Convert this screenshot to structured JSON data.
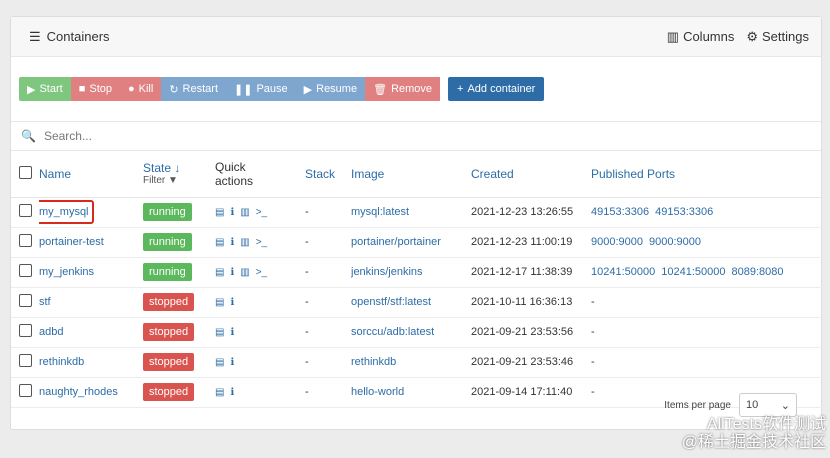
{
  "header": {
    "title": "Containers",
    "columns_label": "Columns",
    "settings_label": "Settings"
  },
  "toolbar": {
    "start": "Start",
    "stop": "Stop",
    "kill": "Kill",
    "restart": "Restart",
    "pause": "Pause",
    "resume": "Resume",
    "remove": "Remove",
    "add": "Add container"
  },
  "search": {
    "placeholder": "Search..."
  },
  "columns": {
    "name": "Name",
    "state": "State",
    "filter": "Filter",
    "quick_actions_1": "Quick",
    "quick_actions_2": "actions",
    "stack": "Stack",
    "image": "Image",
    "created": "Created",
    "ports": "Published Ports"
  },
  "rows": [
    {
      "name": "my_mysql",
      "state": "running",
      "stack": "-",
      "image": "mysql:latest",
      "created": "2021-12-23 13:26:55",
      "ports": [
        "49153:3306",
        "49153:3306"
      ]
    },
    {
      "name": "portainer-test",
      "state": "running",
      "stack": "-",
      "image": "portainer/portainer",
      "created": "2021-12-23 11:00:19",
      "ports": [
        "9000:9000",
        "9000:9000"
      ]
    },
    {
      "name": "my_jenkins",
      "state": "running",
      "stack": "-",
      "image": "jenkins/jenkins",
      "created": "2021-12-17 11:38:39",
      "ports": [
        "10241:50000",
        "10241:50000",
        "8089:8080"
      ]
    },
    {
      "name": "stf",
      "state": "stopped",
      "stack": "-",
      "image": "openstf/stf:latest",
      "created": "2021-10-11 16:36:13",
      "ports_text": "-"
    },
    {
      "name": "adbd",
      "state": "stopped",
      "stack": "-",
      "image": "sorccu/adb:latest",
      "created": "2021-09-21 23:53:56",
      "ports_text": "-"
    },
    {
      "name": "rethinkdb",
      "state": "stopped",
      "stack": "-",
      "image": "rethinkdb",
      "created": "2021-09-21 23:53:46",
      "ports_text": "-"
    },
    {
      "name": "naughty_rhodes",
      "state": "stopped",
      "stack": "-",
      "image": "hello-world",
      "created": "2021-09-14 17:11:40",
      "ports_text": "-"
    }
  ],
  "footer": {
    "items_per_page": "Items per page",
    "value": "10"
  },
  "watermark": {
    "line1": "AllTests软件测试",
    "line2": "@稀土掘金技术社区"
  }
}
